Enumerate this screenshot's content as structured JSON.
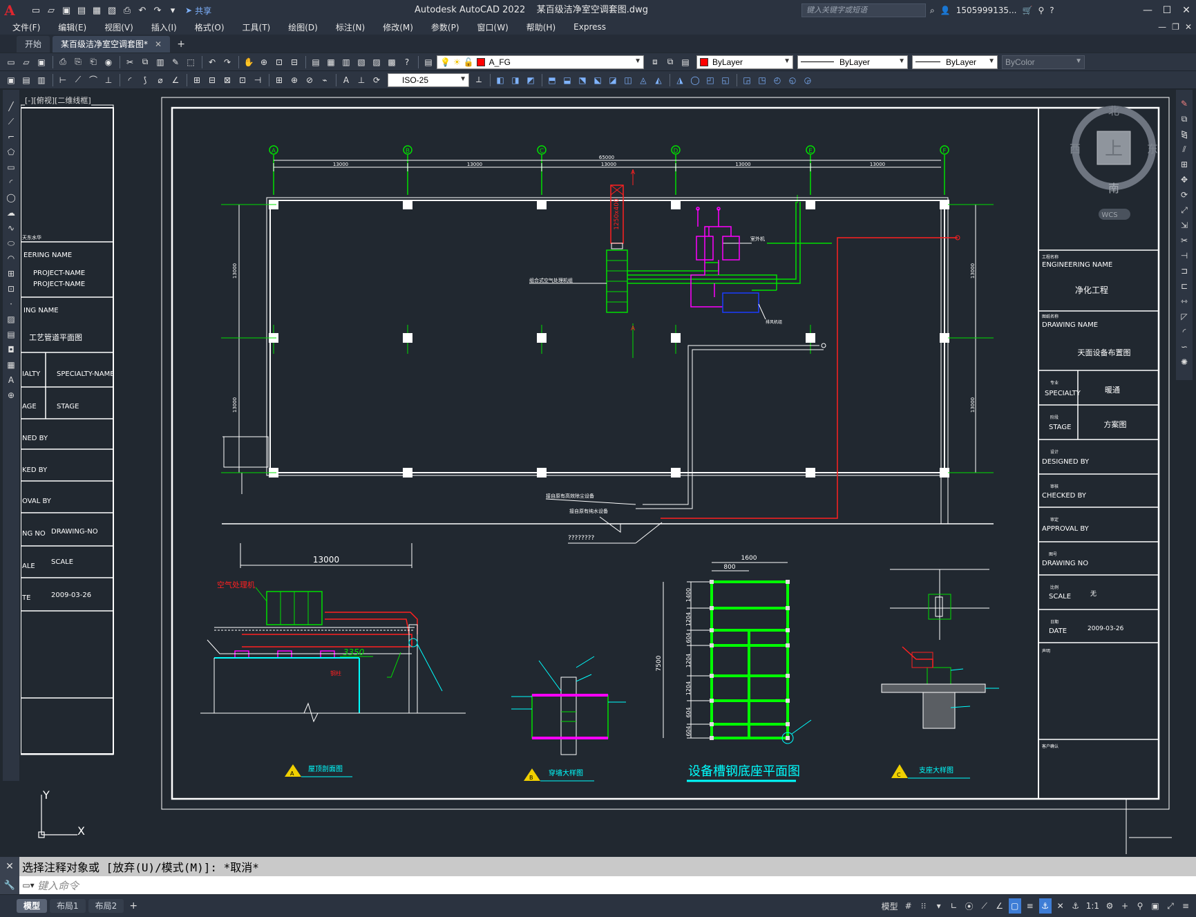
{
  "titlebar": {
    "app_title": "Autodesk AutoCAD 2022",
    "doc_title": "某百级洁净室空调套图.dwg",
    "share_label": "共享",
    "search_placeholder": "键入关键字或短语",
    "username": "1505999135..."
  },
  "menus": [
    "文件(F)",
    "编辑(E)",
    "视图(V)",
    "插入(I)",
    "格式(O)",
    "工具(T)",
    "绘图(D)",
    "标注(N)",
    "修改(M)",
    "参数(P)",
    "窗口(W)",
    "帮助(H)",
    "Express"
  ],
  "file_tabs": [
    {
      "label": "开始"
    },
    {
      "label": "某百级洁净室空调套图*"
    }
  ],
  "toolbar": {
    "layer_name": "A_FG",
    "color": "ByLayer",
    "linetype": "ByLayer",
    "lineweight": "ByLayer",
    "plotstyle": "ByColor",
    "dimstyle": "ISO-25",
    "layer_color": "#ff0000"
  },
  "viewport_label": "[-][俯视][二维线框]",
  "viewcube": {
    "north": "北",
    "south": "南",
    "east": "东",
    "west": "西",
    "face": "上",
    "wcs": "WCS"
  },
  "drawing": {
    "grid_letters": [
      "A",
      "B",
      "C",
      "D",
      "E",
      "F"
    ],
    "overall_dim": "65000",
    "bay_dims": [
      "13000",
      "13000",
      "13000",
      "13000",
      "13000"
    ],
    "side_dims": [
      "13000",
      "13000"
    ],
    "right_side_dims": [
      "13000",
      "13000"
    ],
    "duct_size": "1250x400",
    "ahu_label": "组合式空气处理机组",
    "unit_label": "室外机",
    "fan_label": "排风机组",
    "connect_label_1": "接自原有高效除尘设备",
    "connect_label_2": "接自原有纯水设备",
    "question_label": "????????",
    "section_dim": "13000",
    "section_red_label": "空气处理机",
    "section_elev": "3350",
    "section_small_label": "钢柱",
    "base_dims_top": [
      "1600",
      "800"
    ],
    "base_dims_left": [
      "1400",
      "1204",
      "604",
      "1204",
      "1204",
      "604",
      "604"
    ],
    "base_total": "7500",
    "titles": {
      "a": "屋顶剖面图",
      "b": "穿墙大样图",
      "base": "设备槽钢底座平面图",
      "c": "支座大样图"
    },
    "section_markers": [
      "A",
      "B",
      "C"
    ]
  },
  "left_titleblock": {
    "partial_header": "天东水华",
    "engineering_name": "EERING NAME",
    "project_names": [
      "PROJECT-NAME",
      "PROJECT-NAME"
    ],
    "drawing_name": "ING NAME",
    "drawing_name_value": "工艺管道平面图",
    "specialty": "IALTY",
    "specialty_value": "SPECIALTY-NAME",
    "stage": "AGE",
    "stage_value": "STAGE",
    "designed": "NED BY",
    "checked": "KED BY",
    "approval": "OVAL BY",
    "drawing_no": "NG NO",
    "drawing_no_value": "DRAWING-NO",
    "scale": "ALE",
    "scale_value": "SCALE",
    "date": "TE",
    "date_value": "2009-03-26"
  },
  "right_titleblock": {
    "engineering_name_cn": "工程名称",
    "engineering_name": "ENGINEERING NAME",
    "engineering_value": "净化工程",
    "drawing_name_cn": "图纸名称",
    "drawing_name": "DRAWING NAME",
    "drawing_value": "天面设备布置图",
    "specialty_cn": "专业",
    "specialty": "SPECIALTY",
    "specialty_value": "暖通",
    "stage_cn": "阶段",
    "stage": "STAGE",
    "stage_value": "方案图",
    "designed_cn": "设计",
    "designed": "DESIGNED BY",
    "checked_cn": "审核",
    "checked": "CHECKED BY",
    "approval_cn": "审定",
    "approval": "APPROVAL BY",
    "drawing_no_cn": "图号",
    "drawing_no": "DRAWING NO",
    "scale_cn": "比例",
    "scale": "SCALE",
    "scale_value": "无",
    "date_cn": "日期",
    "date": "DATE",
    "date_value": "2009-03-26",
    "remarks_cn": "声明",
    "signature_cn": "客户确认"
  },
  "ucs": {
    "x": "X",
    "y": "Y"
  },
  "command": {
    "history": "选择注释对象或 [放弃(U)/模式(M)]: *取消*",
    "placeholder": "键入命令"
  },
  "layout_tabs": [
    "模型",
    "布局1",
    "布局2"
  ],
  "status": {
    "model_label": "模型",
    "scale_label": "1:1"
  }
}
